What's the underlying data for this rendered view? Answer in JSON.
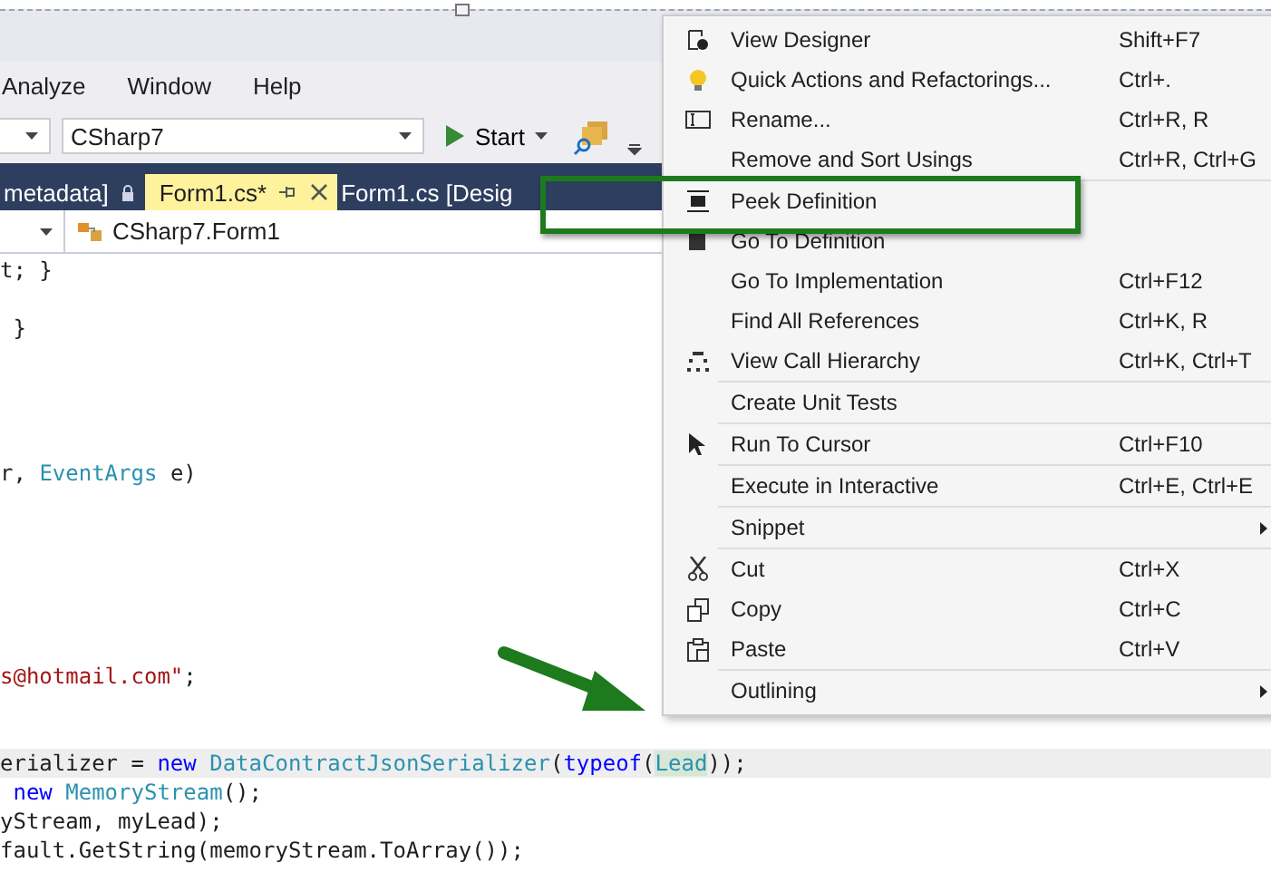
{
  "menubar": [
    "Analyze",
    "Window",
    "Help"
  ],
  "toolbar": {
    "project": "CSharp7",
    "start": "Start"
  },
  "tabs": [
    {
      "label": "metadata]",
      "selected": false,
      "kind": "locked"
    },
    {
      "label": "Form1.cs*",
      "selected": true,
      "kind": "pinned"
    },
    {
      "label": "Form1.cs [Desig",
      "selected": false,
      "kind": "plain"
    }
  ],
  "navbar": {
    "class": "CSharp7.Form1"
  },
  "code": [
    {
      "kind": "code",
      "current": false,
      "segments": [
        {
          "t": "t; }",
          "kind": "plain"
        }
      ]
    },
    {
      "kind": "blank"
    },
    {
      "kind": "code",
      "current": false,
      "segments": [
        {
          "t": " }",
          "kind": "plain"
        }
      ]
    },
    {
      "kind": "blank"
    },
    {
      "kind": "blank"
    },
    {
      "kind": "blank"
    },
    {
      "kind": "blank"
    },
    {
      "kind": "code",
      "current": false,
      "segments": [
        {
          "t": "r, ",
          "kind": "plain"
        },
        {
          "t": "EventArgs",
          "kind": "type"
        },
        {
          "t": " e)",
          "kind": "plain"
        }
      ]
    },
    {
      "kind": "blank"
    },
    {
      "kind": "blank"
    },
    {
      "kind": "blank"
    },
    {
      "kind": "blank"
    },
    {
      "kind": "blank"
    },
    {
      "kind": "blank"
    },
    {
      "kind": "code",
      "current": false,
      "segments": [
        {
          "t": "s@hotmail.com\"",
          "kind": "string"
        },
        {
          "t": ";",
          "kind": "plain"
        }
      ]
    },
    {
      "kind": "blank"
    },
    {
      "kind": "blank"
    },
    {
      "kind": "code",
      "current": true,
      "segments": [
        {
          "t": "erializer = ",
          "kind": "plain"
        },
        {
          "t": "new ",
          "kind": "keyword"
        },
        {
          "t": "DataContractJsonSerializer",
          "kind": "type"
        },
        {
          "t": "(",
          "kind": "plain"
        },
        {
          "t": "typeof",
          "kind": "keyword"
        },
        {
          "t": "(",
          "kind": "plain"
        },
        {
          "t": "Lead",
          "kind": "reference"
        },
        {
          "t": "));",
          "kind": "plain"
        }
      ]
    },
    {
      "kind": "code",
      "current": false,
      "segments": [
        {
          "t": " new ",
          "kind": "keyword"
        },
        {
          "t": "MemoryStream",
          "kind": "type"
        },
        {
          "t": "();",
          "kind": "plain"
        }
      ]
    },
    {
      "kind": "code",
      "current": false,
      "segments": [
        {
          "t": "yStream, myLead);",
          "kind": "plain"
        }
      ]
    },
    {
      "kind": "code",
      "current": false,
      "segments": [
        {
          "t": "fault.GetString(memoryStream.ToArray());",
          "kind": "plain"
        }
      ]
    }
  ],
  "context_menu": [
    {
      "label": "View Designer",
      "shortcut": "Shift+F7",
      "group_start": false,
      "submenu": false
    },
    {
      "label": "Quick Actions and Refactorings...",
      "shortcut": "Ctrl+.",
      "group_start": false,
      "submenu": false
    },
    {
      "label": "Rename...",
      "shortcut": "Ctrl+R, R",
      "group_start": false,
      "submenu": false
    },
    {
      "label": "Remove and Sort Usings",
      "shortcut": "Ctrl+R, Ctrl+G",
      "group_start": false,
      "submenu": false
    },
    {
      "label": "Peek Definition",
      "group_start": true,
      "submenu": false
    },
    {
      "label": "Go To Definition",
      "group_start": false,
      "submenu": false
    },
    {
      "label": "Go To Implementation",
      "shortcut": "Ctrl+F12",
      "group_start": false,
      "submenu": false
    },
    {
      "label": "Find All References",
      "shortcut": "Ctrl+K, R",
      "group_start": false,
      "submenu": false
    },
    {
      "label": "View Call Hierarchy",
      "shortcut": "Ctrl+K, Ctrl+T",
      "group_start": false,
      "submenu": false
    },
    {
      "label": "Create Unit Tests",
      "group_start": true,
      "submenu": false
    },
    {
      "label": "Run To Cursor",
      "shortcut": "Ctrl+F10",
      "group_start": true,
      "submenu": false
    },
    {
      "label": "Execute in Interactive",
      "shortcut": "Ctrl+E, Ctrl+E",
      "group_start": true,
      "submenu": false
    },
    {
      "label": "Snippet",
      "group_start": true,
      "submenu": true
    },
    {
      "label": "Cut",
      "shortcut": "Ctrl+X",
      "group_start": true,
      "submenu": false
    },
    {
      "label": "Copy",
      "shortcut": "Ctrl+C",
      "group_start": false,
      "submenu": false
    },
    {
      "label": "Paste",
      "shortcut": "Ctrl+V",
      "group_start": false,
      "submenu": false
    },
    {
      "label": "Outlining",
      "group_start": true,
      "submenu": true
    }
  ]
}
